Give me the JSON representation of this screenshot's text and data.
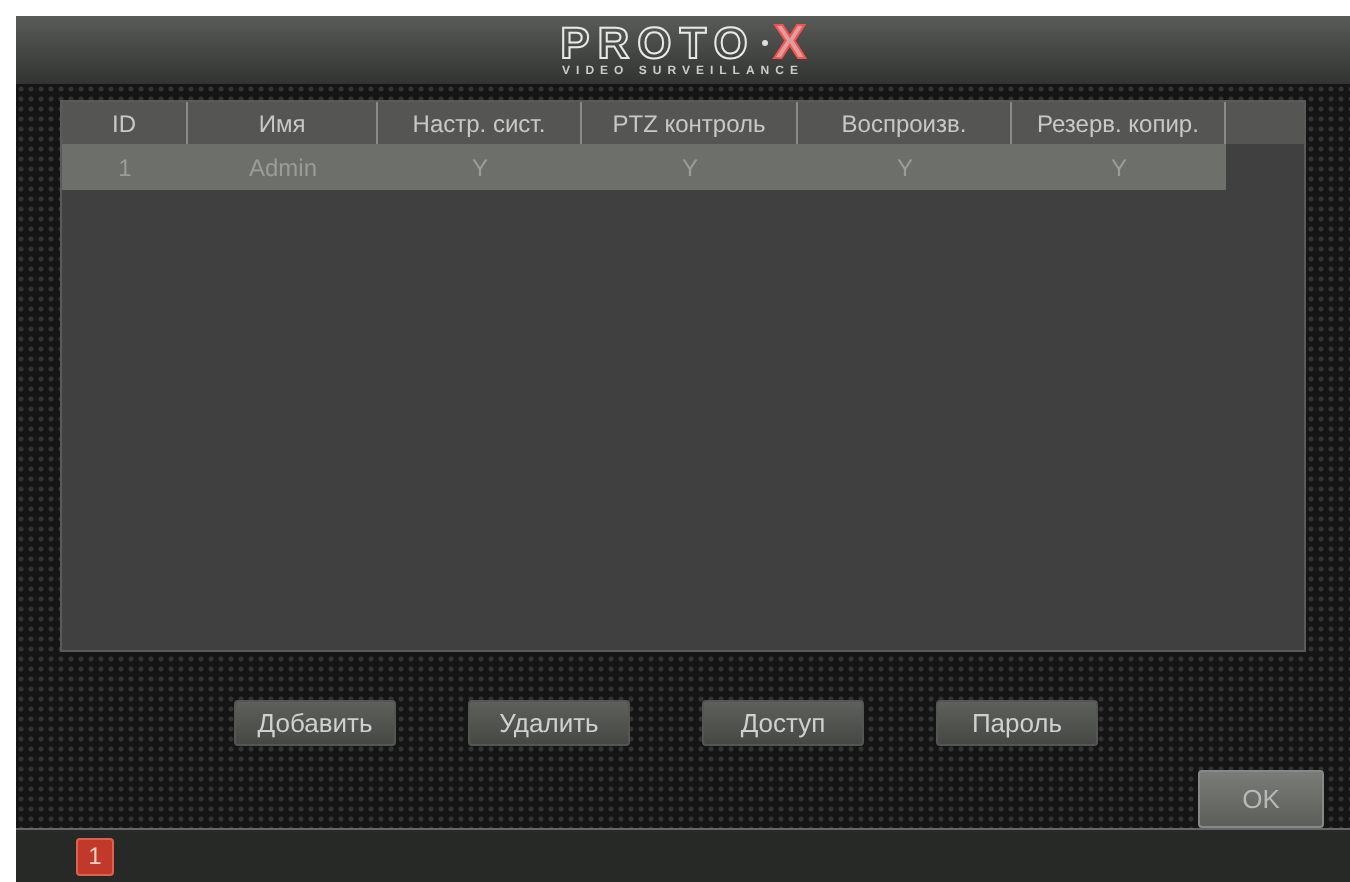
{
  "logo": {
    "brand": "PROTO",
    "mark": "X",
    "tagline": "VIDEO SURVEILLANCE"
  },
  "table": {
    "columns": [
      "ID",
      "Имя",
      "Настр. сист.",
      "PTZ контроль",
      "Воспроизв.",
      "Резерв. копир."
    ],
    "rows": [
      {
        "cells": [
          "1",
          "Admin",
          "Y",
          "Y",
          "Y",
          "Y"
        ],
        "selected": true
      }
    ]
  },
  "buttons": [
    "Добавить",
    "Удалить",
    "Доступ",
    "Пароль"
  ],
  "ok_button": "OK",
  "status_bar": {
    "badge": "1"
  }
}
